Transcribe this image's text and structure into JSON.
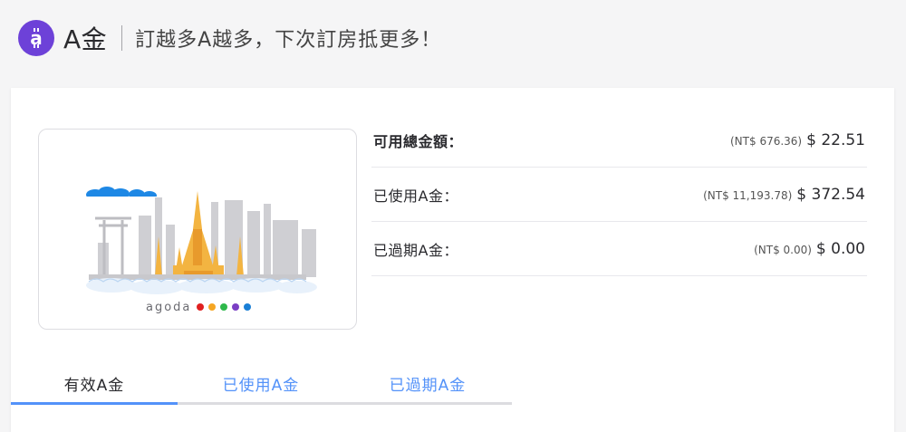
{
  "header": {
    "title": "A金",
    "slogan": "訂越多A越多，下次訂房抵更多！",
    "icon": "coin-icon",
    "accent": "#6d41d8"
  },
  "illustration": {
    "brand": "agoda",
    "dots": [
      "#e02020",
      "#f5a623",
      "#2eb84b",
      "#7b3fc4",
      "#1a7fd6"
    ]
  },
  "summary": {
    "rows": [
      {
        "label": "可用總金額：",
        "sub": "(NT$ 676.36)",
        "value": "$ 22.51"
      },
      {
        "label": "已使用A金：",
        "sub": "(NT$ 11,193.78)",
        "value": "$ 372.54"
      },
      {
        "label": "已過期A金：",
        "sub": "(NT$ 0.00)",
        "value": "$ 0.00"
      }
    ]
  },
  "tabs": [
    {
      "label": "有效A金",
      "active": true
    },
    {
      "label": "已使用A金",
      "active": false
    },
    {
      "label": "已過期A金",
      "active": false
    }
  ],
  "colors": {
    "link": "#5392f9",
    "gold": "#f3b441"
  }
}
